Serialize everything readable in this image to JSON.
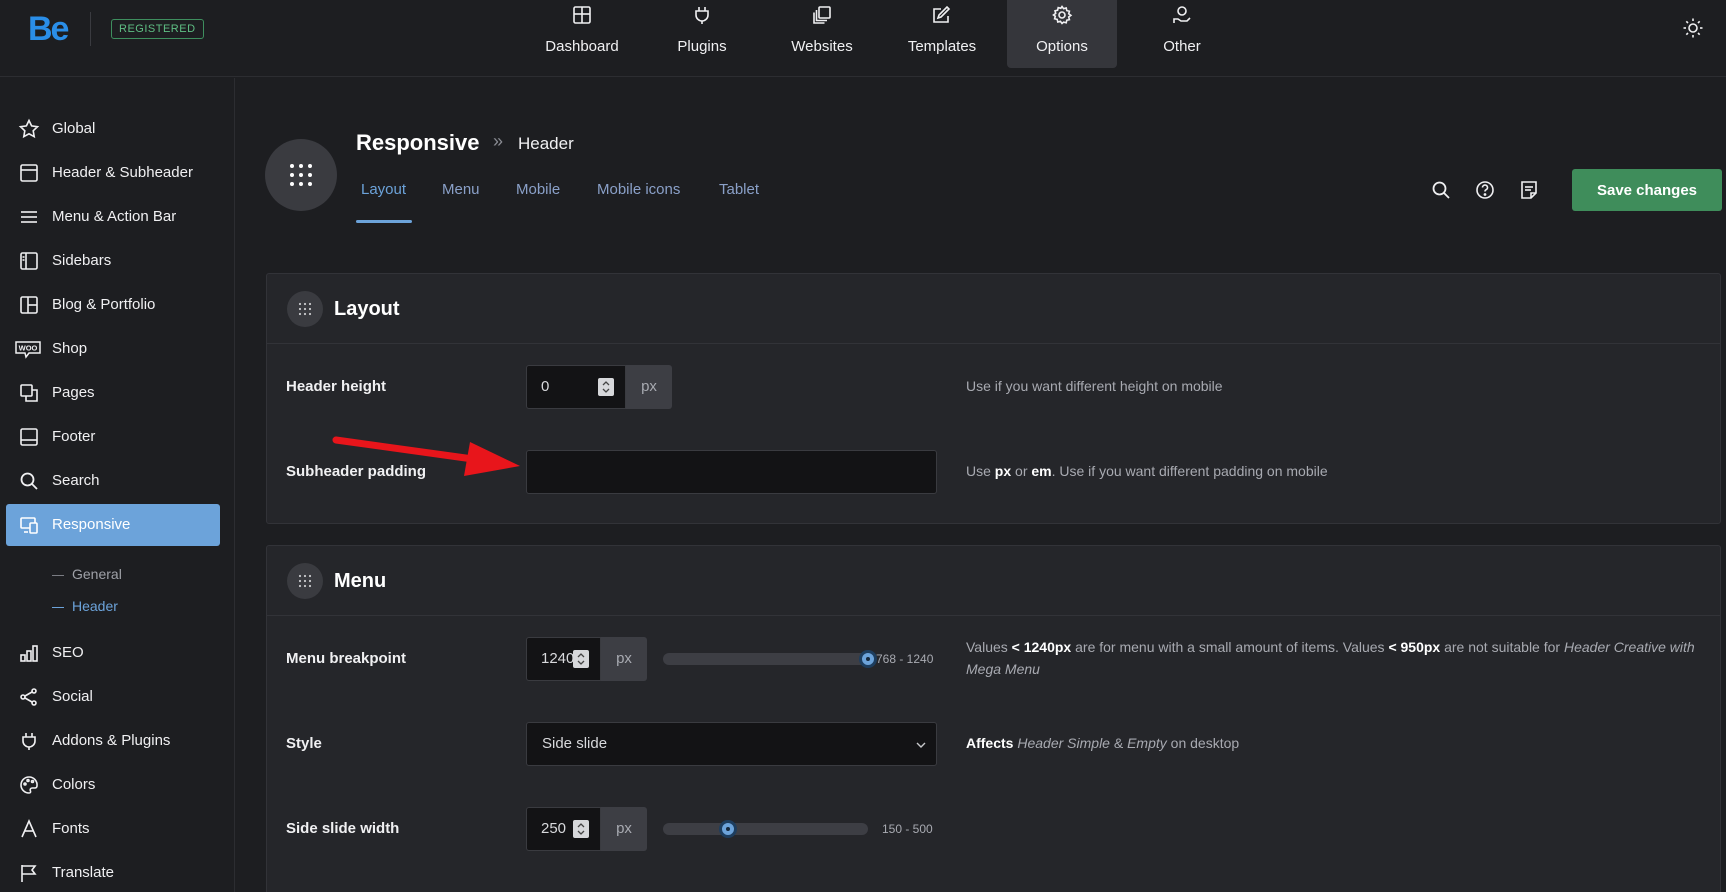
{
  "brand": {
    "logo": "Be",
    "badge": "REGISTERED",
    "accent": "#2a8ee8"
  },
  "topnav": [
    {
      "label": "Dashboard",
      "icon": "dashboard-icon"
    },
    {
      "label": "Plugins",
      "icon": "plug-icon"
    },
    {
      "label": "Websites",
      "icon": "websites-icon"
    },
    {
      "label": "Templates",
      "icon": "templates-icon"
    },
    {
      "label": "Options",
      "icon": "gear-icon",
      "active": true
    },
    {
      "label": "Other",
      "icon": "hand-heart-icon"
    }
  ],
  "sidebar": {
    "items": [
      {
        "label": "Global",
        "icon": "star-icon"
      },
      {
        "label": "Header & Subheader",
        "icon": "header-icon"
      },
      {
        "label": "Menu & Action Bar",
        "icon": "menu-lines-icon"
      },
      {
        "label": "Sidebars",
        "icon": "sidebar-icon"
      },
      {
        "label": "Blog & Portfolio",
        "icon": "blog-icon"
      },
      {
        "label": "Shop",
        "icon": "woo-icon"
      },
      {
        "label": "Pages",
        "icon": "pages-icon"
      },
      {
        "label": "Footer",
        "icon": "footer-icon"
      },
      {
        "label": "Search",
        "icon": "search-icon"
      },
      {
        "label": "Responsive",
        "icon": "responsive-icon",
        "active": true
      },
      {
        "label": "SEO",
        "icon": "bar-chart-icon"
      },
      {
        "label": "Social",
        "icon": "share-icon"
      },
      {
        "label": "Addons & Plugins",
        "icon": "plug-icon"
      },
      {
        "label": "Colors",
        "icon": "palette-icon"
      },
      {
        "label": "Fonts",
        "icon": "font-icon"
      },
      {
        "label": "Translate",
        "icon": "flag-icon"
      }
    ],
    "subitems": [
      {
        "label": "General"
      },
      {
        "label": "Header",
        "active": true
      }
    ],
    "active_color": "#6ca3da"
  },
  "page": {
    "title": "Responsive",
    "separator": "»",
    "breadcrumb": "Header",
    "tabs": [
      "Layout",
      "Menu",
      "Mobile",
      "Mobile icons",
      "Tablet"
    ],
    "active_tab": "Layout",
    "save_label": "Save changes",
    "save_color": "#3f8d5b"
  },
  "layout_panel": {
    "title": "Layout",
    "header_height": {
      "label": "Header height",
      "value": "0",
      "unit": "px",
      "desc": "Use if you want different height on mobile"
    },
    "subheader_padding": {
      "label": "Subheader padding",
      "value": "",
      "desc_pre": "Use ",
      "desc_b1": "px",
      "desc_mid": " or ",
      "desc_b2": "em",
      "desc_post": ". Use if you want different padding on mobile"
    }
  },
  "menu_panel": {
    "title": "Menu",
    "breakpoint": {
      "label": "Menu breakpoint",
      "value": "1240",
      "unit": "px",
      "range": "768 - 1240",
      "min": 768,
      "max": 1240,
      "desc_pre": "Values ",
      "desc_b1": "< 1240px",
      "desc_mid": " are for menu with a small amount of items. Values ",
      "desc_b2": "< 950px",
      "desc_post": " are not suitable for ",
      "desc_i1": "Header Creative with Mega Menu"
    },
    "style": {
      "label": "Style",
      "value": "Side slide",
      "desc_b": "Affects",
      "desc_i1": "Header Simple",
      "desc_mid": " & ",
      "desc_i2": "Empty",
      "desc_post": " on desktop"
    },
    "side_width": {
      "label": "Side slide width",
      "value": "250",
      "unit": "px",
      "range": "150 - 500",
      "min": 150,
      "max": 500
    }
  },
  "annotation_color": "#e8151b"
}
